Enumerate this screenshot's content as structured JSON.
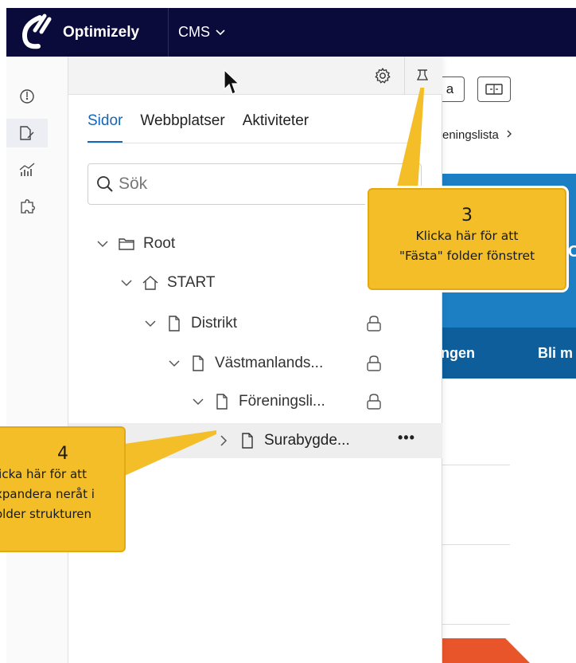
{
  "topbar": {
    "brand": "Optimizely",
    "product": "CMS"
  },
  "rail": {
    "items": [
      "dashboard-icon",
      "edit-page-icon",
      "reports-icon",
      "addons-icon"
    ],
    "active": 1
  },
  "panel": {
    "tabs": [
      {
        "label": "Sidor",
        "active": true
      },
      {
        "label": "Webbplatser",
        "active": false
      },
      {
        "label": "Aktiviteter",
        "active": false
      }
    ],
    "search_placeholder": "Sök",
    "tree": [
      {
        "label": "Root",
        "level": 0,
        "icon": "folder-icon",
        "expanded": true,
        "locked": false
      },
      {
        "label": "START",
        "level": 1,
        "icon": "home-icon",
        "expanded": true,
        "locked": false
      },
      {
        "label": "Distrikt",
        "level": 2,
        "icon": "page-icon",
        "expanded": true,
        "locked": true
      },
      {
        "label": "Västmanlands...",
        "level": 3,
        "icon": "page-icon",
        "expanded": true,
        "locked": true
      },
      {
        "label": "Föreningsli...",
        "level": 4,
        "icon": "page-icon",
        "expanded": true,
        "locked": true
      },
      {
        "label": "Surabygde...",
        "level": 5,
        "icon": "page-icon",
        "expanded": false,
        "locked": false,
        "selected": true,
        "more": "•••"
      }
    ]
  },
  "background": {
    "button_a": "a",
    "breadcrumb": "eningslista",
    "nav_items": [
      "ngen",
      "Bli m"
    ],
    "blue_letter": "C"
  },
  "callouts": {
    "pin": {
      "number": "3",
      "lines": [
        "Klicka här för att",
        "\"Fästa\" folder fönstret"
      ]
    },
    "expand": {
      "number": "4",
      "lines": [
        "licka här för att",
        "xpandera neråt i",
        "older strukturen"
      ]
    }
  },
  "colors": {
    "topbar": "#0b0b3b",
    "accent": "#1466b8",
    "callout": "#f3be27",
    "blue_banner": "#1c7fc4",
    "nav": "#0d5e9a"
  }
}
